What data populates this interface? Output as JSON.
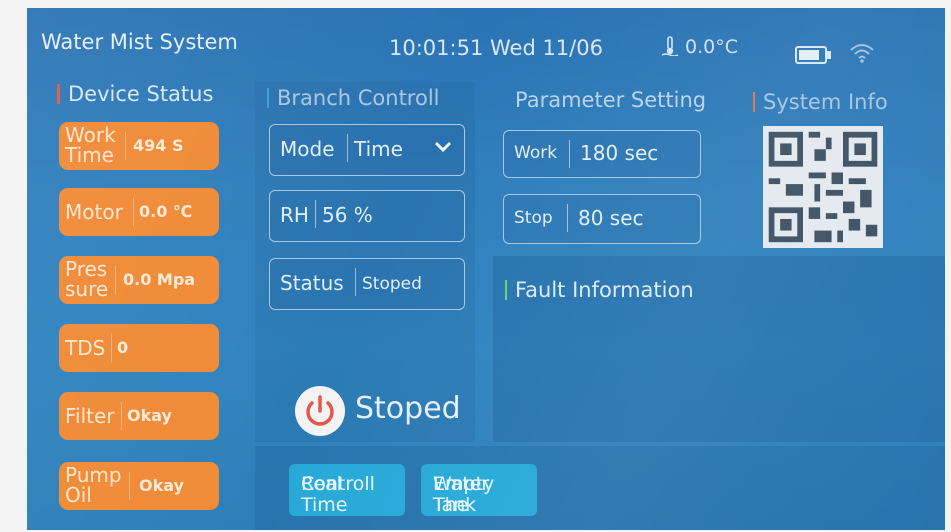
{
  "header": {
    "title": "Water Mist System",
    "datetime": "10:01:51 Wed 11/06",
    "temperature": "0.0°C"
  },
  "sections": {
    "device_status": "Device Status",
    "branch_control": "Branch Controll",
    "parameter_setting": "Parameter Setting",
    "system_info": "System Info",
    "fault_information": "Fault Information"
  },
  "device_status": [
    {
      "label_line1": "Work",
      "label_line2": "Time",
      "value": "494 S"
    },
    {
      "label_line1": "Motor",
      "label_line2": "",
      "value": "0.0 ℃"
    },
    {
      "label_line1": "Pres",
      "label_line2": "sure",
      "value": "0.0 Mpa"
    },
    {
      "label_line1": "TDS",
      "label_line2": "",
      "value": "0"
    },
    {
      "label_line1": "Filter",
      "label_line2": "",
      "value": "Okay"
    },
    {
      "label_line1": "Pump",
      "label_line2": "Oil",
      "value": "Okay"
    }
  ],
  "branch": {
    "mode_label": "Mode",
    "mode_value": "Time",
    "rh_label": "RH",
    "rh_value": "56 %",
    "status_label": "Status",
    "status_value": "Stoped",
    "running_state": "Stoped"
  },
  "parameters": {
    "work_label": "Work",
    "work_value": "180 sec",
    "stop_label": "Stop",
    "stop_value": "80 sec"
  },
  "buttons": {
    "real_time_line1": "Real Time",
    "real_time_line2": "Controll",
    "empty_tank_line1": "Empty The",
    "empty_tank_line2": "Water Tank"
  },
  "colors": {
    "background": "#2f7fbd",
    "status_button": "#f08a36",
    "action_button": "#27a9d8",
    "accent_red": "#e2574c",
    "accent_green": "#6fd36a"
  }
}
